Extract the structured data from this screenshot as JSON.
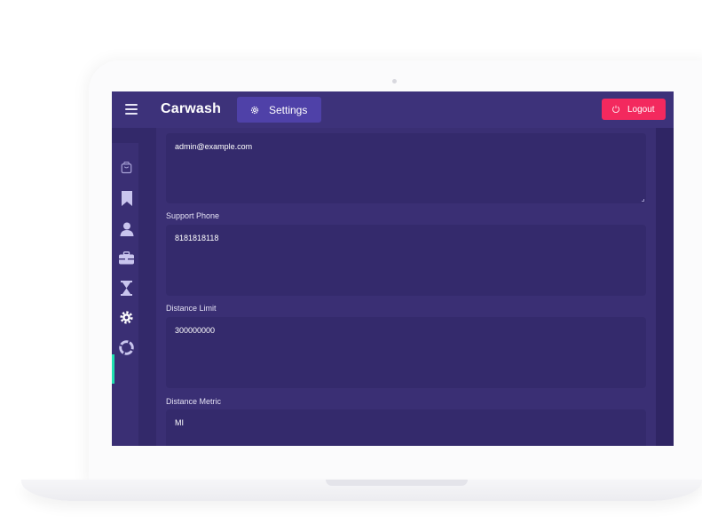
{
  "app": {
    "brand": "Carwash",
    "active_tab": "Settings",
    "logout_label": "Logout"
  },
  "sidebar": {
    "items": [
      {
        "icon": "shopping-bag-icon"
      },
      {
        "icon": "bookmark-icon"
      },
      {
        "icon": "user-icon"
      },
      {
        "icon": "briefcase-icon"
      },
      {
        "icon": "hourglass-icon"
      },
      {
        "icon": "gear-icon",
        "active": true
      },
      {
        "icon": "lifebuoy-icon"
      }
    ]
  },
  "form": {
    "support_email": {
      "value": "admin@example.com"
    },
    "support_phone": {
      "label": "Support Phone",
      "value": "8181818118"
    },
    "distance_limit": {
      "label": "Distance Limit",
      "value": "300000000"
    },
    "distance_metric": {
      "label": "Distance Metric",
      "value": "MI"
    }
  },
  "colors": {
    "topbar": "#3d327a",
    "accent_tab": "#4f41a8",
    "logout": "#f3295e",
    "active_indicator": "#1fe0b0",
    "background": "#33296a"
  }
}
